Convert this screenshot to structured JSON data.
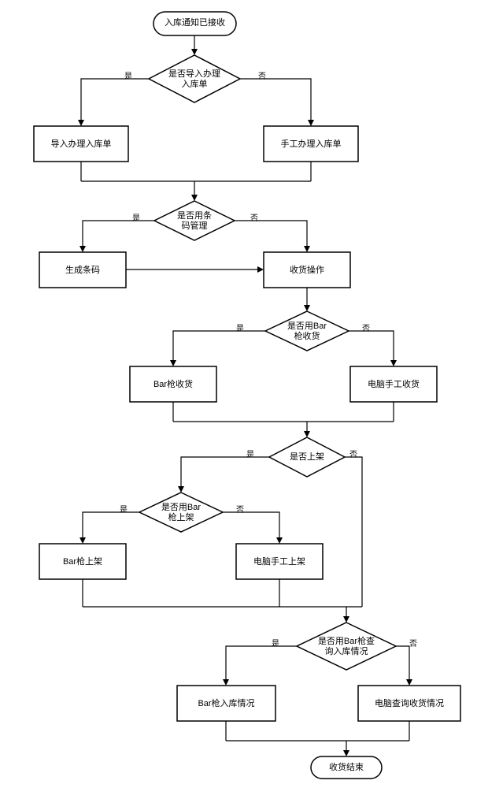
{
  "nodes": {
    "start": "入库通知已接收",
    "d1": "是否导入办理\n入库单",
    "p1": "导入办理入库单",
    "p2": "手工办理入库单",
    "d2": "是否用条\n码管理",
    "p3": "生成条码",
    "p4": "收货操作",
    "d3": "是否用Bar\n枪收货",
    "p5": "Bar枪收货",
    "p6": "电脑手工收货",
    "d4": "是否上架",
    "d5": "是否用Bar\n枪上架",
    "p7": "Bar枪上架",
    "p8": "电脑手工上架",
    "d6": "是否用Bar枪查\n询入库情况",
    "p9": "Bar枪入库情况",
    "p10": "电脑查询收货情况",
    "end": "收货结束"
  },
  "edges": {
    "yes": "是",
    "no": "否"
  }
}
